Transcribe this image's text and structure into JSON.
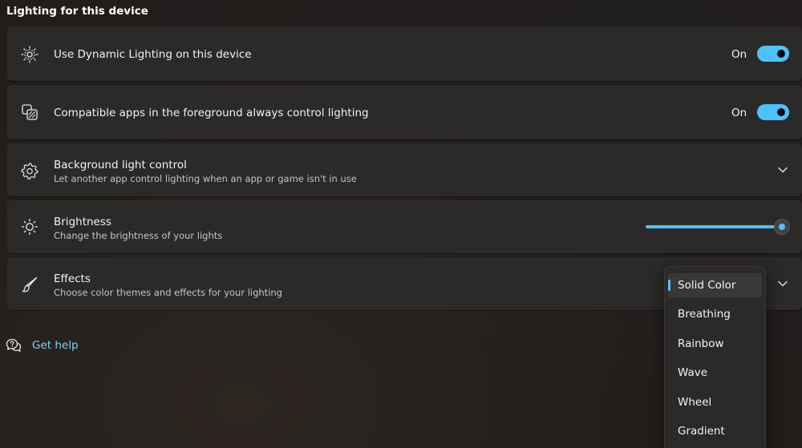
{
  "section": {
    "title": "Lighting for this device"
  },
  "cards": {
    "dynamic": {
      "title": "Use Dynamic Lighting on this device",
      "state": "On",
      "on": true
    },
    "foreground": {
      "title": "Compatible apps in the foreground always control lighting",
      "state": "On",
      "on": true
    },
    "background": {
      "title": "Background light control",
      "subtitle": "Let another app control lighting when an app or game isn't in use"
    },
    "brightness": {
      "title": "Brightness",
      "subtitle": "Change the brightness of your lights",
      "value_percent": 100
    },
    "effects": {
      "title": "Effects",
      "subtitle": "Choose color themes and effects for your lighting",
      "selected": "Solid Color"
    }
  },
  "effects_dropdown": {
    "options": [
      "Solid Color",
      "Breathing",
      "Rainbow",
      "Wave",
      "Wheel",
      "Gradient"
    ]
  },
  "help": {
    "label": "Get help"
  },
  "colors": {
    "accent": "#4cc2ff",
    "card": "#2c2a28",
    "link": "#7dd3ff"
  },
  "icons": {
    "dynamic": "dynamic-lighting-icon",
    "foreground": "app-layers-icon",
    "background": "gear-icon",
    "brightness": "sun-icon",
    "effects": "brush-icon",
    "help": "help-chat-icon",
    "expand": "chevron-down-icon"
  }
}
